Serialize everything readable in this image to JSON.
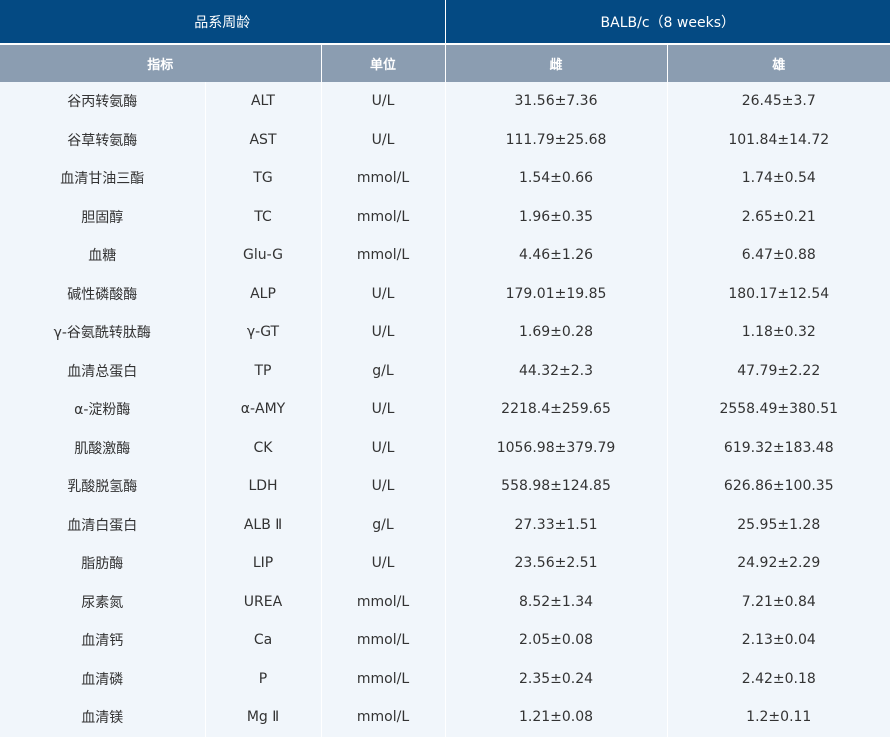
{
  "table": {
    "header": {
      "strain_label": "品系周龄",
      "strain_value": "BALB/c（8 weeks）",
      "col_indicator": "指标",
      "col_unit": "单位",
      "col_female": "雌",
      "col_male": "雄"
    },
    "rows": [
      {
        "name": "谷丙转氨酶",
        "abbr": "ALT",
        "unit": "U/L",
        "female": "31.56±7.36",
        "male": "26.45±3.7"
      },
      {
        "name": "谷草转氨酶",
        "abbr": "AST",
        "unit": "U/L",
        "female": "111.79±25.68",
        "male": "101.84±14.72"
      },
      {
        "name": "血清甘油三酯",
        "abbr": "TG",
        "unit": "mmol/L",
        "female": "1.54±0.66",
        "male": "1.74±0.54"
      },
      {
        "name": "胆固醇",
        "abbr": "TC",
        "unit": "mmol/L",
        "female": "1.96±0.35",
        "male": "2.65±0.21"
      },
      {
        "name": "血糖",
        "abbr": "Glu-G",
        "unit": "mmol/L",
        "female": "4.46±1.26",
        "male": "6.47±0.88"
      },
      {
        "name": "碱性磷酸酶",
        "abbr": "ALP",
        "unit": "U/L",
        "female": "179.01±19.85",
        "male": "180.17±12.54"
      },
      {
        "name": "γ-谷氨酰转肽酶",
        "abbr": "γ-GT",
        "unit": "U/L",
        "female": "1.69±0.28",
        "male": "1.18±0.32"
      },
      {
        "name": "血清总蛋白",
        "abbr": "TP",
        "unit": "g/L",
        "female": "44.32±2.3",
        "male": "47.79±2.22"
      },
      {
        "name": "α-淀粉酶",
        "abbr": "α-AMY",
        "unit": "U/L",
        "female": "2218.4±259.65",
        "male": "2558.49±380.51"
      },
      {
        "name": "肌酸激酶",
        "abbr": "CK",
        "unit": "U/L",
        "female": "1056.98±379.79",
        "male": "619.32±183.48"
      },
      {
        "name": "乳酸脱氢酶",
        "abbr": "LDH",
        "unit": "U/L",
        "female": "558.98±124.85",
        "male": "626.86±100.35"
      },
      {
        "name": "血清白蛋白",
        "abbr": "ALB Ⅱ",
        "unit": "g/L",
        "female": "27.33±1.51",
        "male": "25.95±1.28"
      },
      {
        "name": "脂肪酶",
        "abbr": "LIP",
        "unit": "U/L",
        "female": "23.56±2.51",
        "male": "24.92±2.29"
      },
      {
        "name": "尿素氮",
        "abbr": "UREA",
        "unit": "mmol/L",
        "female": "8.52±1.34",
        "male": "7.21±0.84"
      },
      {
        "name": "血清钙",
        "abbr": "Ca",
        "unit": "mmol/L",
        "female": "2.05±0.08",
        "male": "2.13±0.04"
      },
      {
        "name": "血清磷",
        "abbr": "P",
        "unit": "mmol/L",
        "female": "2.35±0.24",
        "male": "2.42±0.18"
      },
      {
        "name": "血清镁",
        "abbr": "Mg Ⅱ",
        "unit": "mmol/L",
        "female": "1.21±0.08",
        "male": "1.2±0.11"
      }
    ]
  }
}
